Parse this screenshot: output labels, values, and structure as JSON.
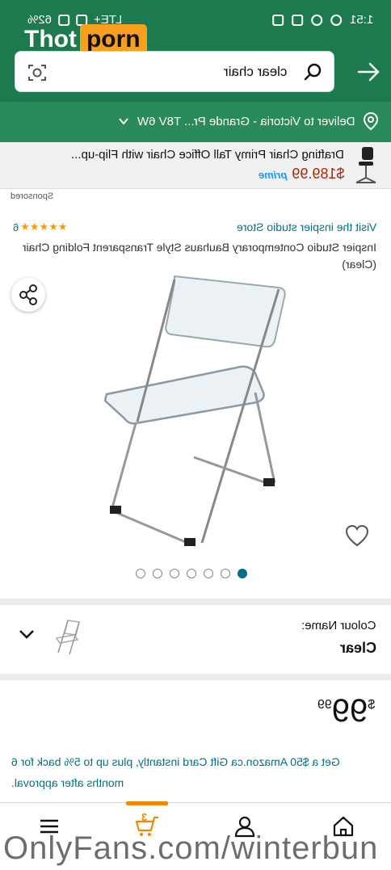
{
  "status_bar": {
    "time": "1:51",
    "battery": "62%",
    "network": "LTE+"
  },
  "watermark_logo": {
    "part1": "Thot",
    "part2": "porn"
  },
  "search": {
    "query": "clear chair"
  },
  "delivery": {
    "text": "Deliver to Victoria - Grande Pr... T8V 6W"
  },
  "sponsored_ad": {
    "title": "Drafting Chair Primy Tall Office Chair with Flip-up...",
    "price": "$189.99",
    "prime": "prime"
  },
  "sponsored_label": "Sponsored",
  "product": {
    "store_link": "Visit the inspier studio Store",
    "rating_count": "6",
    "title": "Inspier Studio Contemporary Bauhaus Style Transparent Folding Chair (Clear)",
    "image_count": 7,
    "active_image_index": 7
  },
  "colour": {
    "label": "Colour Name:",
    "value": "Clear"
  },
  "price": {
    "currency": "$",
    "whole": "99",
    "cents": "99"
  },
  "promo": "Get a $50 Amazon.ca Gift Card instantly, plus up to 5% back for 6 months after approval.",
  "cart_count": "3",
  "watermark_text": "OnlyFans.com/winterbun",
  "colors": {
    "header": "#1c7a4e",
    "link": "#007185",
    "price_red": "#b12704",
    "star": "#ff9900",
    "cart_accent": "#f08804"
  }
}
